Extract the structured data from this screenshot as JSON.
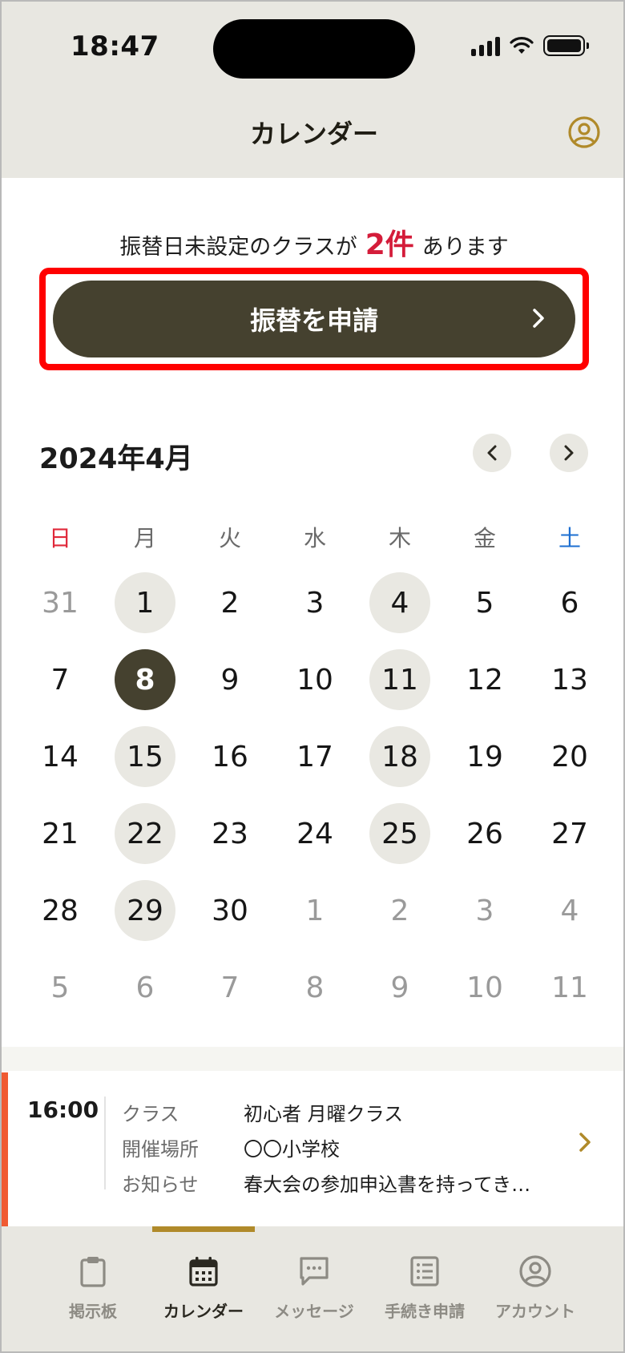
{
  "status_bar": {
    "time": "18:47"
  },
  "header": {
    "title": "カレンダー",
    "profile_icon": "user-circle-icon"
  },
  "notice": {
    "prefix": "振替日未設定のクラスが",
    "count": "2件",
    "suffix": "あります",
    "count_color": "#d41c3a"
  },
  "cta": {
    "label": "振替を申請"
  },
  "calendar": {
    "month_label": "2024年4月",
    "weekdays": [
      "日",
      "月",
      "火",
      "水",
      "木",
      "金",
      "土"
    ],
    "days": [
      {
        "label": "31",
        "muted": true
      },
      {
        "label": "1",
        "class": true
      },
      {
        "label": "2"
      },
      {
        "label": "3"
      },
      {
        "label": "4",
        "class": true
      },
      {
        "label": "5"
      },
      {
        "label": "6"
      },
      {
        "label": "7"
      },
      {
        "label": "8",
        "selected": true
      },
      {
        "label": "9"
      },
      {
        "label": "10"
      },
      {
        "label": "11",
        "class": true
      },
      {
        "label": "12"
      },
      {
        "label": "13"
      },
      {
        "label": "14"
      },
      {
        "label": "15",
        "class": true
      },
      {
        "label": "16"
      },
      {
        "label": "17"
      },
      {
        "label": "18",
        "class": true
      },
      {
        "label": "19"
      },
      {
        "label": "20"
      },
      {
        "label": "21"
      },
      {
        "label": "22",
        "class": true
      },
      {
        "label": "23"
      },
      {
        "label": "24"
      },
      {
        "label": "25",
        "class": true
      },
      {
        "label": "26"
      },
      {
        "label": "27"
      },
      {
        "label": "28"
      },
      {
        "label": "29",
        "class": true
      },
      {
        "label": "30"
      },
      {
        "label": "1",
        "muted": true
      },
      {
        "label": "2",
        "muted": true
      },
      {
        "label": "3",
        "muted": true
      },
      {
        "label": "4",
        "muted": true
      },
      {
        "label": "5",
        "muted": true
      },
      {
        "label": "6",
        "muted": true
      },
      {
        "label": "7",
        "muted": true
      },
      {
        "label": "8",
        "muted": true
      },
      {
        "label": "9",
        "muted": true
      },
      {
        "label": "10",
        "muted": true
      },
      {
        "label": "11",
        "muted": true
      }
    ]
  },
  "event": {
    "time": "16:00",
    "rows": [
      {
        "key": "クラス",
        "value": "初心者 月曜クラス"
      },
      {
        "key": "開催場所",
        "value": "〇〇小学校"
      },
      {
        "key": "お知らせ",
        "value": "春大会の参加申込書を持ってき…"
      }
    ]
  },
  "tabbar": {
    "tabs": [
      {
        "label": "掲示板",
        "icon": "clipboard-icon"
      },
      {
        "label": "カレンダー",
        "icon": "calendar-icon"
      },
      {
        "label": "メッセージ",
        "icon": "message-icon"
      },
      {
        "label": "手続き申請",
        "icon": "list-icon"
      },
      {
        "label": "アカウント",
        "icon": "user-circle-icon"
      }
    ],
    "active": "カレンダー"
  },
  "colors": {
    "brand_dark": "#45412f",
    "accent_gold": "#b08a2a",
    "event_bar": "#f05a32",
    "header_bg": "#e8e7e1"
  }
}
